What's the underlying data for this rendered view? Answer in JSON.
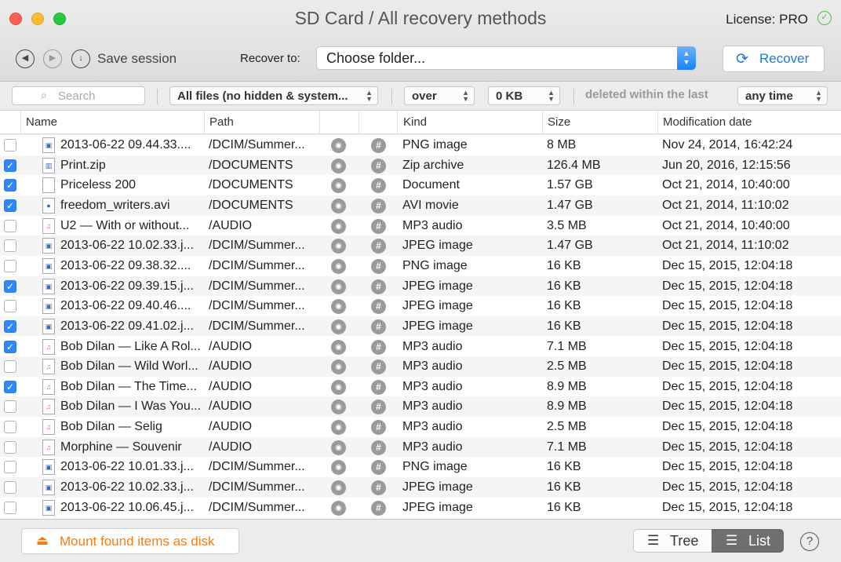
{
  "window": {
    "title": "SD Card / All recovery methods",
    "license": "License: PRO"
  },
  "toolbar": {
    "save_session": "Save session",
    "recover_to_label": "Recover to:",
    "choose_folder": "Choose folder...",
    "recover": "Recover"
  },
  "filters": {
    "search_placeholder": "Search",
    "file_filter": "All files (no hidden & system...",
    "size_op": "over",
    "size_value": "0 KB",
    "deleted_label": "deleted within the last",
    "time_range": "any time"
  },
  "columns": {
    "name": "Name",
    "path": "Path",
    "kind": "Kind",
    "size": "Size",
    "modified": "Modification date"
  },
  "rows": [
    {
      "checked": false,
      "icon": "image",
      "name": "2013-06-22 09.44.33....",
      "path": "/DCIM/Summer...",
      "kind": "PNG image",
      "size": "8 MB",
      "date": "Nov 24, 2014, 16:42:24"
    },
    {
      "checked": true,
      "icon": "zip",
      "name": "Print.zip",
      "path": "/DOCUMENTS",
      "kind": "Zip archive",
      "size": "126.4 MB",
      "date": "Jun 20, 2016, 12:15:56"
    },
    {
      "checked": true,
      "icon": "doc",
      "name": "Priceless 200",
      "path": "/DOCUMENTS",
      "kind": "Document",
      "size": "1.57 GB",
      "date": "Oct 21, 2014, 10:40:00"
    },
    {
      "checked": true,
      "icon": "movie",
      "name": "freedom_writers.avi",
      "path": "/DOCUMENTS",
      "kind": "AVI movie",
      "size": "1.47 GB",
      "date": "Oct 21, 2014, 11:10:02"
    },
    {
      "checked": false,
      "icon": "music",
      "name": "U2 — With or without...",
      "path": "/AUDIO",
      "kind": "MP3 audio",
      "size": "3.5 MB",
      "date": "Oct 21, 2014, 10:40:00"
    },
    {
      "checked": false,
      "icon": "image",
      "name": "2013-06-22 10.02.33.j...",
      "path": "/DCIM/Summer...",
      "kind": "JPEG image",
      "size": "1.47 GB",
      "date": "Oct 21, 2014, 11:10:02"
    },
    {
      "checked": false,
      "icon": "image",
      "name": "2013-06-22 09.38.32....",
      "path": "/DCIM/Summer...",
      "kind": "PNG image",
      "size": "16 KB",
      "date": "Dec 15, 2015, 12:04:18"
    },
    {
      "checked": true,
      "icon": "image",
      "name": "2013-06-22 09.39.15.j...",
      "path": "/DCIM/Summer...",
      "kind": "JPEG image",
      "size": "16 KB",
      "date": "Dec 15, 2015, 12:04:18"
    },
    {
      "checked": false,
      "icon": "image",
      "name": "2013-06-22 09.40.46....",
      "path": "/DCIM/Summer...",
      "kind": "JPEG image",
      "size": "16 KB",
      "date": "Dec 15, 2015, 12:04:18"
    },
    {
      "checked": true,
      "icon": "image",
      "name": "2013-06-22 09.41.02.j...",
      "path": "/DCIM/Summer...",
      "kind": "JPEG image",
      "size": "16 KB",
      "date": "Dec 15, 2015, 12:04:18"
    },
    {
      "checked": true,
      "icon": "music",
      "name": "Bob Dilan — Like A Rol...",
      "path": "/AUDIO",
      "kind": "MP3 audio",
      "size": "7.1 MB",
      "date": "Dec 15, 2015, 12:04:18"
    },
    {
      "checked": false,
      "icon": "music",
      "name": "Bob Dilan — Wild Worl...",
      "path": "/AUDIO",
      "kind": "MP3 audio",
      "size": "2.5 MB",
      "date": "Dec 15, 2015, 12:04:18"
    },
    {
      "checked": true,
      "icon": "music",
      "name": "Bob Dilan — The Time...",
      "path": "/AUDIO",
      "kind": "MP3 audio",
      "size": "8.9 MB",
      "date": "Dec 15, 2015, 12:04:18"
    },
    {
      "checked": false,
      "icon": "music",
      "name": "Bob Dilan — I Was You...",
      "path": "/AUDIO",
      "kind": "MP3 audio",
      "size": "8.9 MB",
      "date": "Dec 15, 2015, 12:04:18"
    },
    {
      "checked": false,
      "icon": "music",
      "name": "Bob Dilan — Selig",
      "path": "/AUDIO",
      "kind": "MP3 audio",
      "size": "2.5 MB",
      "date": "Dec 15, 2015, 12:04:18"
    },
    {
      "checked": false,
      "icon": "music",
      "name": "Morphine — Souvenir",
      "path": "/AUDIO",
      "kind": "MP3 audio",
      "size": "7.1 MB",
      "date": "Dec 15, 2015, 12:04:18"
    },
    {
      "checked": false,
      "icon": "image",
      "name": "2013-06-22 10.01.33.j...",
      "path": "/DCIM/Summer...",
      "kind": "PNG image",
      "size": "16 KB",
      "date": "Dec 15, 2015, 12:04:18"
    },
    {
      "checked": false,
      "icon": "image",
      "name": "2013-06-22 10.02.33.j...",
      "path": "/DCIM/Summer...",
      "kind": "JPEG image",
      "size": "16 KB",
      "date": "Dec 15, 2015, 12:04:18"
    },
    {
      "checked": false,
      "icon": "image",
      "name": "2013-06-22 10.06.45.j...",
      "path": "/DCIM/Summer...",
      "kind": "JPEG image",
      "size": "16 KB",
      "date": "Dec 15, 2015, 12:04:18"
    }
  ],
  "bottom": {
    "mount": "Mount found items as disk",
    "tree": "Tree",
    "list": "List",
    "help": "?"
  },
  "colors": {
    "accent": "#1a7ae0",
    "mount_orange": "#f07f1a",
    "checkbox_on": "#2f88fb",
    "list_active": "#6f6f6f"
  }
}
